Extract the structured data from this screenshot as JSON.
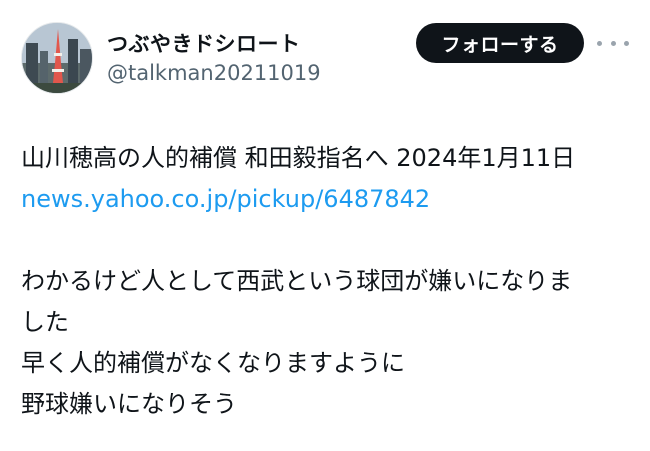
{
  "user": {
    "display_name": "つぶやきドシロート",
    "handle": "@talkman20211019"
  },
  "actions": {
    "follow_label": "フォローする",
    "more_icon": "more-horizontal-icon"
  },
  "tweet": {
    "line1": "山川穂高の人的補償 和田毅指名へ 2024年1月11日",
    "link": "news.yahoo.co.jp/pickup/6487842",
    "line3": "わかるけど人として西武という球団が嫌いになりま",
    "line4": "した",
    "line5": "早く人的補償がなくなりますように",
    "line6": "野球嫌いになりそう"
  },
  "colors": {
    "text": "#0f1419",
    "secondary": "#536471",
    "link": "#1d9bf0",
    "follow_button_bg": "#0f1419"
  }
}
